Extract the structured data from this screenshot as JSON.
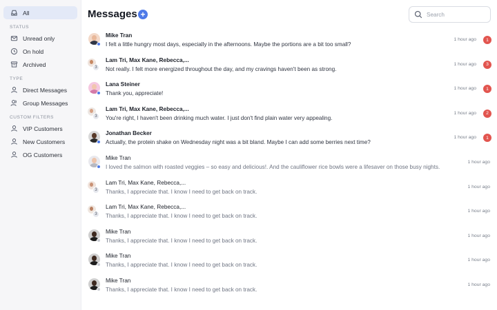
{
  "sidebar": {
    "all_label": "All",
    "sections": {
      "status": "STATUS",
      "type": "TYPE",
      "custom_filters": "CUSTOM FILTERS"
    },
    "status_items": [
      {
        "label": "Unread only",
        "icon": "mail-icon"
      },
      {
        "label": "On hold",
        "icon": "clock-icon"
      },
      {
        "label": "Archived",
        "icon": "archive-icon"
      }
    ],
    "type_items": [
      {
        "label": "Direct Messages",
        "icon": "user-icon"
      },
      {
        "label": "Group Messages",
        "icon": "users-icon"
      }
    ],
    "filter_items": [
      {
        "label": "VIP Customers",
        "icon": "user-icon"
      },
      {
        "label": "New Customers",
        "icon": "user-icon"
      },
      {
        "label": "OG Customers",
        "icon": "user-icon"
      }
    ]
  },
  "header": {
    "title": "Messages",
    "add_icon": "plus-icon",
    "search_placeholder": "Search"
  },
  "colors": {
    "accent": "#4e7ae8",
    "badge": "#e2554f",
    "active_bg": "#e3e9f7",
    "online_dot": "#4e7ae8"
  },
  "messages": [
    {
      "name": "Mike Tran",
      "preview": "I felt a little hungry most days, especially in the afternoons. Maybe the portions are a bit too small?",
      "time": "1 hour ago",
      "unread": "1",
      "group": false
    },
    {
      "name": "Lam Tri, Max Kane, Rebecca,...",
      "preview": "Not really. I felt more energized throughout the day, and my cravings haven't been as strong.",
      "time": "1 hour ago",
      "unread": "3",
      "group": true,
      "group_count": "3"
    },
    {
      "name": "Lana Steiner",
      "preview": "Thank you, appreciate!",
      "time": "1 hour ago",
      "unread": "1",
      "group": false
    },
    {
      "name": "Lam Tri, Max Kane, Rebecca,...",
      "preview": "You're right, I haven't been drinking much water. I just don't find plain water very appealing.",
      "time": "1 hour ago",
      "unread": "2",
      "group": true,
      "group_count": "3"
    },
    {
      "name": "Jonathan Becker",
      "preview": "Actually, the protein shake on Wednesday night was a bit bland. Maybe I can add some berries next time?",
      "time": "1 hour ago",
      "unread": "1",
      "group": false
    },
    {
      "name": "Mike Tran",
      "preview": "I loved the salmon with roasted veggies – so easy and delicious!. And the cauliflower rice bowls were a lifesaver on those busy nights.",
      "time": "1 hour ago",
      "group": false
    },
    {
      "name": "Lam Tri, Max Kane, Rebecca,...",
      "preview": "Thanks, I appreciate that. I know I need to get back on track.",
      "time": "1 hour ago",
      "group": true,
      "group_count": "3"
    },
    {
      "name": "Lam Tri, Max Kane, Rebecca,...",
      "preview": "Thanks, I appreciate that. I know I need to get back on track.",
      "time": "1 hour ago",
      "group": true,
      "group_count": "3"
    },
    {
      "name": "Mike Tran",
      "preview": "Thanks, I appreciate that. I know I need to get back on track.",
      "time": "1 hour ago",
      "group": false
    },
    {
      "name": "Mike Tran",
      "preview": "Thanks, I appreciate that. I know I need to get back on track.",
      "time": "1 hour ago",
      "group": false
    },
    {
      "name": "Mike Tran",
      "preview": "Thanks, I appreciate that. I know I need to get back on track.",
      "time": "1 hour ago",
      "group": false
    }
  ]
}
